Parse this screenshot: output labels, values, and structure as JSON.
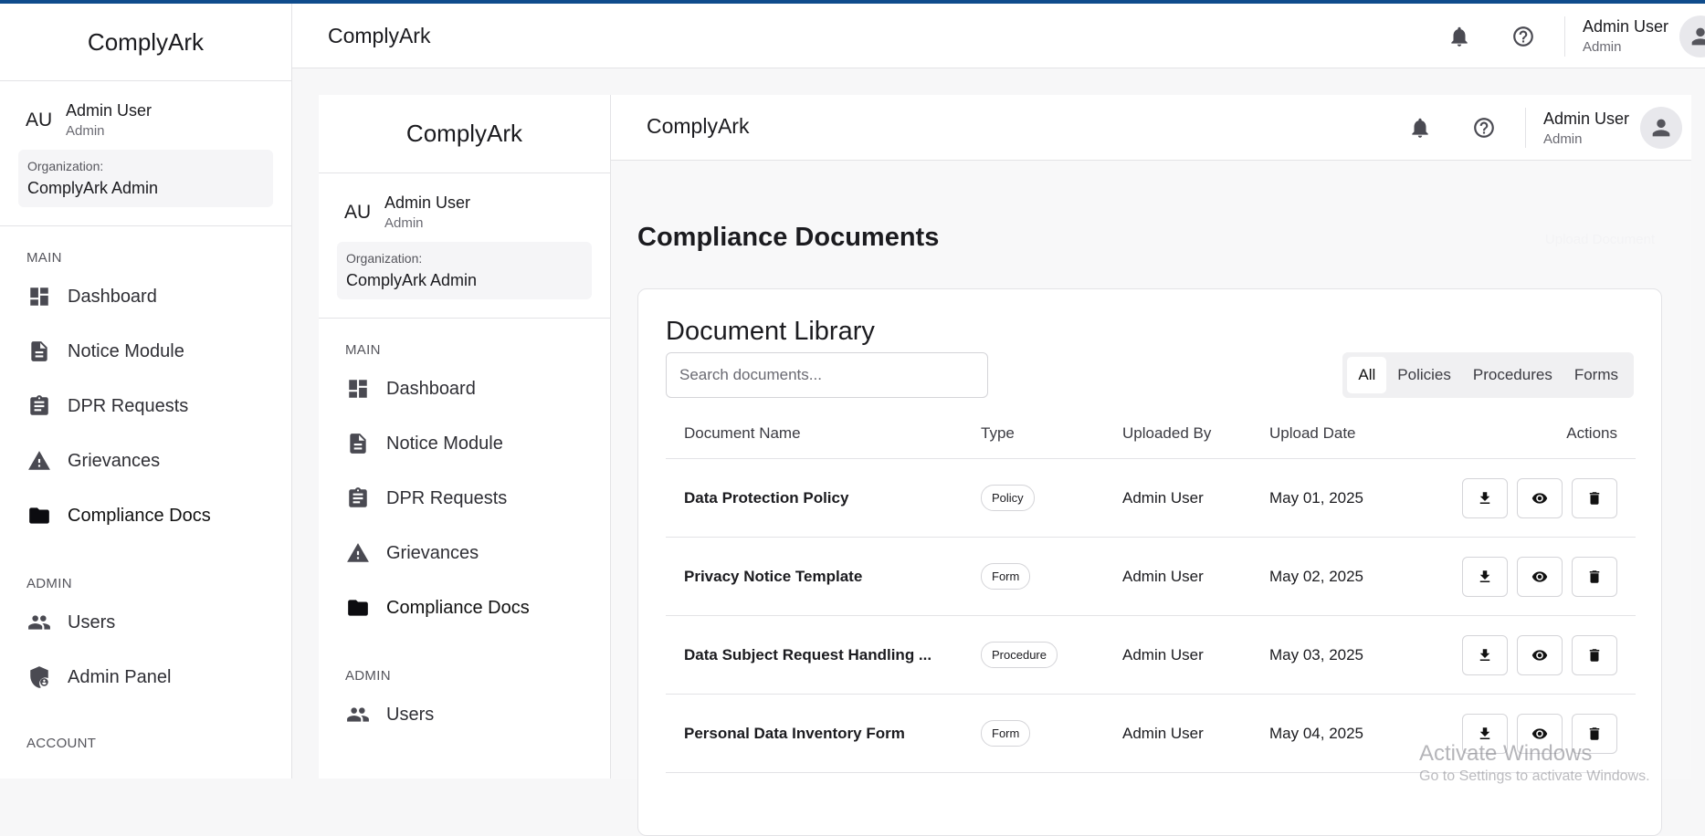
{
  "brand": "ComplyArk",
  "header": {
    "title": "ComplyArk",
    "user_name": "Admin User",
    "user_role": "Admin"
  },
  "sidebar": {
    "initials": "AU",
    "user_name": "Admin User",
    "user_role": "Admin",
    "org_label": "Organization:",
    "org_name": "ComplyArk Admin",
    "sections": {
      "main": "MAIN",
      "admin": "ADMIN",
      "account": "ACCOUNT"
    },
    "main_items": [
      {
        "label": "Dashboard",
        "icon": "dashboard-icon"
      },
      {
        "label": "Notice Module",
        "icon": "document-icon"
      },
      {
        "label": "DPR Requests",
        "icon": "clipboard-icon"
      },
      {
        "label": "Grievances",
        "icon": "warning-icon"
      },
      {
        "label": "Compliance Docs",
        "icon": "folder-icon",
        "active": true
      }
    ],
    "admin_items": [
      {
        "label": "Users",
        "icon": "users-icon"
      },
      {
        "label": "Admin Panel",
        "icon": "admin-shield-icon"
      }
    ]
  },
  "page": {
    "title": "Compliance Documents",
    "ghost_action": "Upload Document",
    "library_title": "Document Library",
    "search_placeholder": "Search documents...",
    "tabs": [
      "All",
      "Policies",
      "Procedures",
      "Forms"
    ],
    "active_tab": "All",
    "columns": [
      "Document Name",
      "Type",
      "Uploaded By",
      "Upload Date",
      "Actions"
    ],
    "rows": [
      {
        "name": "Data Protection Policy",
        "type": "Policy",
        "uploaded_by": "Admin User",
        "date": "May 01, 2025"
      },
      {
        "name": "Privacy Notice Template",
        "type": "Form",
        "uploaded_by": "Admin User",
        "date": "May 02, 2025"
      },
      {
        "name": "Data Subject Request Handling ...",
        "type": "Procedure",
        "uploaded_by": "Admin User",
        "date": "May 03, 2025"
      },
      {
        "name": "Personal Data Inventory Form",
        "type": "Form",
        "uploaded_by": "Admin User",
        "date": "May 04, 2025"
      }
    ]
  },
  "watermark": {
    "title": "Activate Windows",
    "subtitle": "Go to Settings to activate Windows."
  },
  "colors": {
    "top_accent": "#0f4c8c",
    "active_nav": "#0c0c10"
  }
}
